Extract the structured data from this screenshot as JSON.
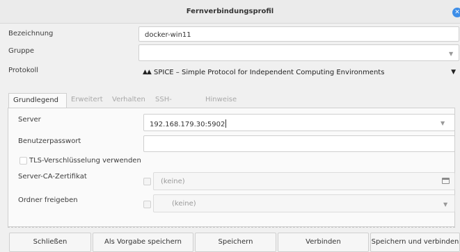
{
  "window": {
    "title": "Fernverbindungsprofil"
  },
  "form": {
    "name_label": "Bezeichnung",
    "name_value": "docker-win11",
    "group_label": "Gruppe",
    "group_value": "",
    "protocol_label": "Protokoll",
    "protocol_value": "SPICE – Simple Protocol for Independent Computing Environments",
    "protocol_icon": "spice-logo-icon"
  },
  "tabs": [
    {
      "label": "Grundlegend",
      "active": true
    },
    {
      "label": "Erweitert",
      "active": false
    },
    {
      "label": "Verhalten",
      "active": false
    },
    {
      "label": "SSH-Tunnel",
      "active": false
    },
    {
      "label": "Hinweise",
      "active": false
    }
  ],
  "basic": {
    "server_label": "Server",
    "server_value": "192.168.179.30:5902",
    "password_label": "Benutzerpasswort",
    "password_value": "",
    "tls_label": "TLS-Verschlüsselung verwenden",
    "tls_checked": false,
    "ca_label": "Server-CA-Zertifikat",
    "ca_value": "(keine)",
    "share_label": "Ordner freigeben",
    "share_value": "(keine)"
  },
  "buttons": {
    "close": "Schließen",
    "save_default": "Als Vorgabe speichern",
    "save": "Speichern",
    "connect": "Verbinden",
    "save_connect": "Speichern und verbinden"
  },
  "colors": {
    "accent": "#3d8ee8"
  }
}
